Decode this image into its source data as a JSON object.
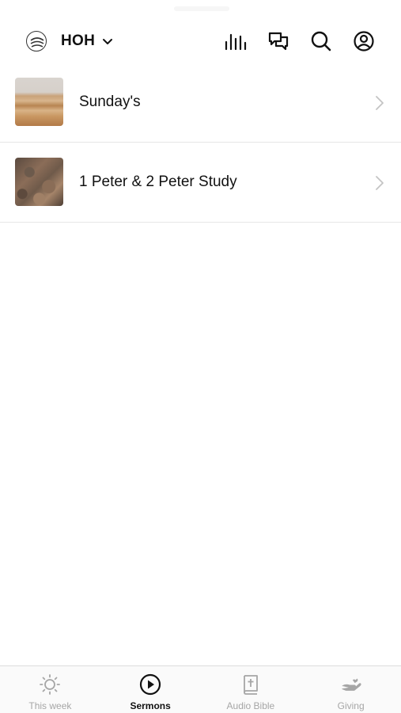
{
  "header": {
    "org_name": "HOH",
    "org_logo_icon": "church-logo-icon",
    "actions": [
      {
        "icon": "audio-bars-icon"
      },
      {
        "icon": "chat-bubbles-icon"
      },
      {
        "icon": "search-icon"
      },
      {
        "icon": "profile-icon"
      }
    ]
  },
  "list": {
    "items": [
      {
        "label": "Sunday's",
        "thumbnail": "desert-dunes-thumbnail"
      },
      {
        "label": "1 Peter & 2 Peter Study",
        "thumbnail": "rocky-terrain-thumbnail"
      }
    ]
  },
  "tabbar": {
    "tabs": [
      {
        "label": "This week",
        "icon": "sun-icon",
        "active": false
      },
      {
        "label": "Sermons",
        "icon": "play-circle-icon",
        "active": true
      },
      {
        "label": "Audio Bible",
        "icon": "bible-icon",
        "active": false
      },
      {
        "label": "Giving",
        "icon": "hand-icon",
        "active": false
      }
    ]
  },
  "colors": {
    "active_text": "#111111",
    "inactive_text": "#a6a6a6",
    "divider": "#e6e6e6"
  }
}
